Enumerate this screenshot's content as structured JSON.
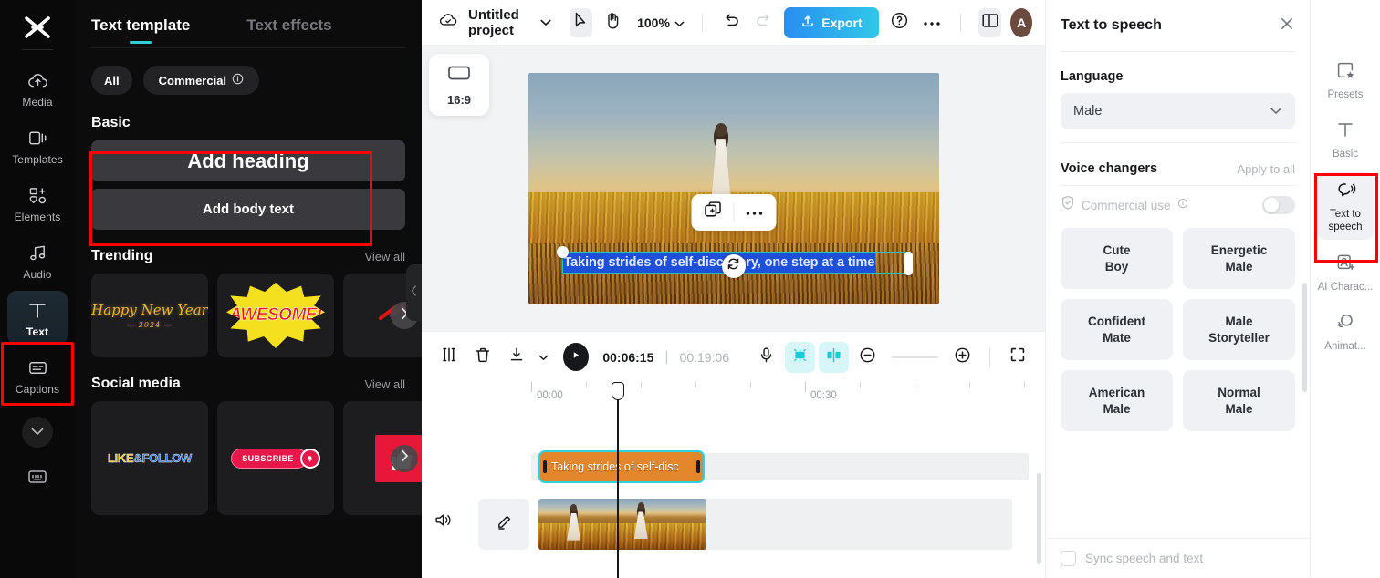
{
  "left_rail": {
    "logo": "capcut-logo",
    "items": [
      {
        "label": "Media",
        "icon": "cloud-upload-icon",
        "active": false
      },
      {
        "label": "Templates",
        "icon": "templates-icon",
        "active": false
      },
      {
        "label": "Elements",
        "icon": "elements-icon",
        "active": false
      },
      {
        "label": "Audio",
        "icon": "music-note-icon",
        "active": false
      },
      {
        "label": "Text",
        "icon": "text-t-icon",
        "active": true
      },
      {
        "label": "Captions",
        "icon": "captions-icon",
        "active": false
      }
    ],
    "collapse_icon": "chevron-down-icon",
    "keyboard_icon": "keyboard-icon"
  },
  "text_panel": {
    "tabs": [
      {
        "label": "Text template",
        "active": true
      },
      {
        "label": "Text effects",
        "active": false
      }
    ],
    "chips": [
      {
        "label": "All"
      },
      {
        "label": "Commercial",
        "info_icon": "info-icon"
      }
    ],
    "basic": {
      "title": "Basic",
      "items": [
        {
          "label": "Add heading"
        },
        {
          "label": "Add body text"
        }
      ]
    },
    "trending": {
      "title": "Trending",
      "view_all": "View all",
      "thumbs": [
        {
          "name": "happy-new-year-template",
          "text": "Happy New Year",
          "sub": "— 2024 —"
        },
        {
          "name": "awesome-template",
          "text": "AWESOME!"
        },
        {
          "name": "red-lightning-template",
          "text": ""
        }
      ]
    },
    "social": {
      "title": "Social media",
      "view_all": "View all",
      "thumbs": [
        {
          "name": "like-follow-template",
          "text_a": "LIKE",
          "text_b": "&FOLLOW"
        },
        {
          "name": "subscribe-template",
          "text": "SUBSCRIBE"
        },
        {
          "name": "thumbs-up-template",
          "text": ""
        }
      ]
    },
    "collapse_icon": "chevron-left-icon"
  },
  "topbar": {
    "cloud_icon": "cloud-saved-icon",
    "project_name": "Untitled project",
    "project_menu_icon": "chevron-down-icon",
    "select_tool_icon": "cursor-arrow-icon",
    "hand_tool_icon": "hand-icon",
    "zoom_level": "100%",
    "zoom_caret_icon": "chevron-down-icon",
    "undo_icon": "undo-icon",
    "redo_icon": "redo-icon",
    "export_label": "Export",
    "export_icon": "upload-icon",
    "help_icon": "question-circle-icon",
    "more_icon": "ellipsis-icon",
    "layout_icon": "split-layout-icon",
    "avatar_letter": "A"
  },
  "preview": {
    "ratio_label": "16:9",
    "ratio_icon": "aspect-ratio-icon",
    "floating_tools": {
      "copy_icon": "duplicate-icon",
      "more_icon": "ellipsis-icon"
    },
    "overlay_text": "Taking strides of self-discovery, one step at a time",
    "rotate_icon": "rotate-icon"
  },
  "controls": {
    "split_icon": "split-clip-icon",
    "delete_icon": "trash-icon",
    "download_icon": "download-icon",
    "download_caret_icon": "chevron-down-icon",
    "play_icon": "play-icon",
    "current_time": "00:06:15",
    "total_time": "00:19:06",
    "mic_icon": "microphone-icon",
    "autocut_icon": "magic-cut-icon",
    "mirror_icon": "mirror-icon",
    "zoom_out_icon": "minus-circle-icon",
    "zoom_in_icon": "plus-circle-icon",
    "fullscreen_icon": "fullscreen-icon"
  },
  "timeline": {
    "ruler_labels": [
      "00:00",
      "00:30"
    ],
    "text_clip_label": "Taking strides of self-disc",
    "volume_icon": "speaker-icon",
    "edit_icon": "pencil-icon"
  },
  "right_panel": {
    "title": "Text to speech",
    "close_icon": "close-icon",
    "language_label": "Language",
    "language_value": "Male",
    "language_caret_icon": "chevron-down-icon",
    "voice_changers_label": "Voice changers",
    "apply_to_all_label": "Apply to all",
    "commercial_use_label": "Commercial use",
    "commercial_shield_icon": "shield-check-icon",
    "commercial_info_icon": "info-icon",
    "commercial_toggle": "off",
    "voices": [
      {
        "line1": "Cute",
        "line2": "Boy"
      },
      {
        "line1": "Energetic",
        "line2": "Male"
      },
      {
        "line1": "Confident",
        "line2": "Mate"
      },
      {
        "line1": "Male",
        "line2": "Storyteller"
      },
      {
        "line1": "American",
        "line2": "Male"
      },
      {
        "line1": "Normal",
        "line2": "Male"
      }
    ],
    "sync_label": "Sync speech and text",
    "sync_checked": false
  },
  "right_rail": {
    "items": [
      {
        "label": "Presets",
        "icon": "presets-icon",
        "active": false
      },
      {
        "label": "Basic",
        "icon": "text-t-icon",
        "active": false
      },
      {
        "label": "Text to speech",
        "icon": "speech-head-icon",
        "active": true
      },
      {
        "label": "AI Charac...",
        "icon": "ai-character-icon",
        "active": false
      },
      {
        "label": "Animat...",
        "icon": "animation-icon",
        "active": false
      }
    ]
  },
  "colors": {
    "accent_teal": "#31d0d8",
    "export_gradient_from": "#2a8df2",
    "export_gradient_to": "#31c8e8",
    "highlight_red": "#ff0000",
    "clip_orange": "#e3862c",
    "selection_blue": "#1d4fd8"
  }
}
